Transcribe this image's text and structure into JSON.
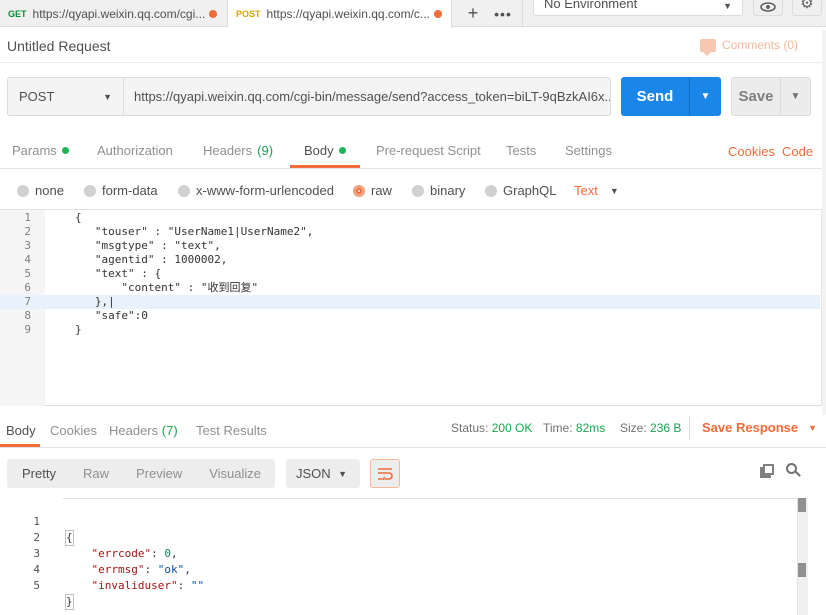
{
  "tabs": [
    {
      "method": "GET",
      "url": "https://qyapi.weixin.qq.com/cgi...",
      "unsaved": true,
      "active": false
    },
    {
      "method": "POST",
      "url": "https://qyapi.weixin.qq.com/c...",
      "unsaved": true,
      "active": true
    }
  ],
  "tab_actions": {
    "add_icon": "plus-icon",
    "more_icon": "more-icon"
  },
  "environment": {
    "selected": "No Environment"
  },
  "env_actions": {
    "eye_icon": "eye-icon",
    "settings_icon": "gear-icon"
  },
  "request": {
    "title": "Untitled Request",
    "comments_label": "Comments (0)",
    "method": "POST",
    "url": "https://qyapi.weixin.qq.com/cgi-bin/message/send?access_token=biLT-9qBzkAI6x...",
    "send_label": "Send",
    "save_label": "Save"
  },
  "request_tabs": [
    {
      "label": "Params",
      "dot": true
    },
    {
      "label": "Authorization",
      "dot": false
    },
    {
      "label": "Headers",
      "count": "(9)"
    },
    {
      "label": "Body",
      "dot": true,
      "active": true
    },
    {
      "label": "Pre-request Script"
    },
    {
      "label": "Tests"
    },
    {
      "label": "Settings"
    }
  ],
  "request_links": {
    "cookies": "Cookies",
    "code": "Code"
  },
  "body_modes": [
    {
      "label": "none",
      "selected": false
    },
    {
      "label": "form-data",
      "selected": false
    },
    {
      "label": "x-www-form-urlencoded",
      "selected": false
    },
    {
      "label": "raw",
      "selected": true
    },
    {
      "label": "binary",
      "selected": false
    },
    {
      "label": "GraphQL",
      "selected": false
    }
  ],
  "raw_type": "Text",
  "editor_lines": [
    {
      "n": "1",
      "text": "{"
    },
    {
      "n": "2",
      "text": "   \"touser\" : \"UserName1|UserName2\","
    },
    {
      "n": "3",
      "text": "   \"msgtype\" : \"text\","
    },
    {
      "n": "4",
      "text": "   \"agentid\" : 1000002,"
    },
    {
      "n": "5",
      "text": "   \"text\" : {"
    },
    {
      "n": "6",
      "text": "       \"content\" : \"收到回复\""
    },
    {
      "n": "7",
      "text": "   },|"
    },
    {
      "n": "8",
      "text": "   \"safe\":0"
    },
    {
      "n": "9",
      "text": "}"
    }
  ],
  "response_tabs": [
    {
      "label": "Body",
      "active": true
    },
    {
      "label": "Cookies"
    },
    {
      "label": "Headers",
      "count": "(7)"
    },
    {
      "label": "Test Results"
    }
  ],
  "response_status": {
    "status_label": "Status:",
    "status_value": "200 OK",
    "time_label": "Time:",
    "time_value": "82ms",
    "size_label": "Size:",
    "size_value": "236 B",
    "save_response": "Save Response"
  },
  "response_formats": [
    "Pretty",
    "Raw",
    "Preview",
    "Visualize"
  ],
  "response_language": "JSON",
  "response_lines": [
    {
      "n": "1",
      "text": "{"
    },
    {
      "n": "2",
      "key": "\"errcode\"",
      "val": "0",
      "vtype": "n",
      "trail": ","
    },
    {
      "n": "3",
      "key": "\"errmsg\"",
      "val": "\"ok\"",
      "vtype": "s",
      "trail": ","
    },
    {
      "n": "4",
      "key": "\"invaliduser\"",
      "val": "\"\"",
      "vtype": "s",
      "trail": ""
    },
    {
      "n": "5",
      "text": "}"
    }
  ]
}
